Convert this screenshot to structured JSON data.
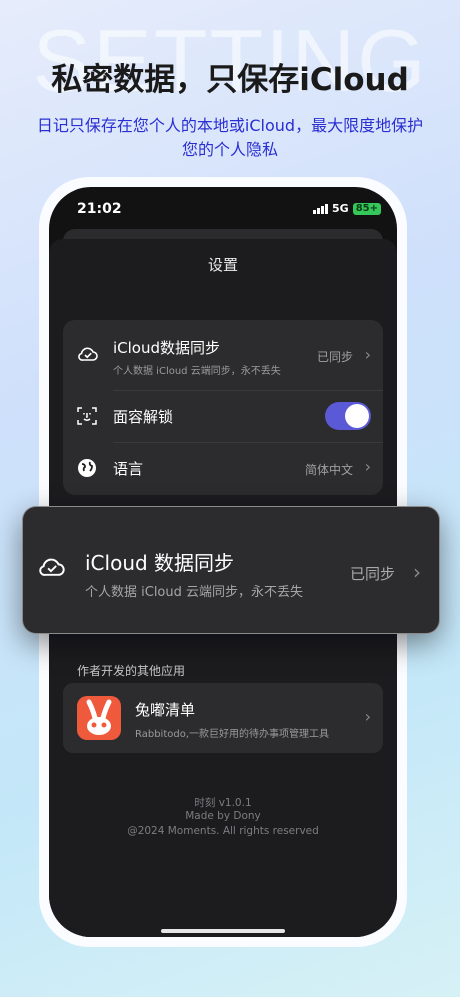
{
  "promo": {
    "watermark": "SETTING",
    "headline": "私密数据，只保存iCloud",
    "subline": "日记只保存在您个人的本地或iCloud，最大限度地保护您的个人隐私"
  },
  "status_bar": {
    "time": "21:02",
    "network": "5G",
    "battery": "85+"
  },
  "settings": {
    "title": "设置",
    "rows": [
      {
        "title": "iCloud数据同步",
        "subtitle": "个人数据 iCloud 云端同步，永不丢失",
        "value": "已同步",
        "icon": "cloud-check-icon"
      },
      {
        "title": "面容解锁",
        "toggle_on": true,
        "icon": "face-id-icon"
      },
      {
        "title": "语言",
        "value": "简体中文",
        "icon": "globe-icon"
      }
    ],
    "other_apps_label": "作者开发的其他应用",
    "app": {
      "name": "兔嘟清单",
      "description": "Rabbitodo,一款巨好用的待办事项管理工具",
      "icon": "rabbit-app-icon"
    },
    "footer": {
      "version": "时刻   v1.0.1",
      "author": "Made by Dony",
      "copyright": "@2024 Moments. All rights reserved"
    }
  },
  "popup": {
    "title": "iCloud 数据同步",
    "subtitle": "个人数据 iCloud 云端同步，永不丢失",
    "value": "已同步",
    "icon": "cloud-check-icon"
  },
  "colors": {
    "accent": "#5a5ad6",
    "subline": "#2a2fd2",
    "app_icon": "#f05a3c"
  }
}
